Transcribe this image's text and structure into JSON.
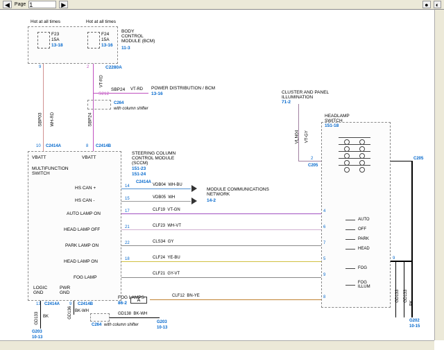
{
  "toolbar": {
    "prev": "◀",
    "next": "▶",
    "page_label": "Page",
    "page_value": "1",
    "btn1": "●",
    "btn2": "◐"
  },
  "hot": "Hot at all times",
  "fuses": {
    "f23": {
      "name": "F23",
      "amps": "15A",
      "ref": "13-18"
    },
    "f24": {
      "name": "F24",
      "amps": "15A",
      "ref": "13-16"
    }
  },
  "modules": {
    "bcm": {
      "title": "BODY\nCONTROL\nMODULE (BCM)",
      "ref": "11-3"
    },
    "multifunction": {
      "title": "MULTIFUNCTION\nSWITCH"
    },
    "sccm": {
      "title": "STEERING COLUMN\nCONTROL MODULE\n(SCCM)",
      "ref1": "151-23",
      "ref2": "151-24"
    },
    "headlamp": {
      "title": "HEADLAMP\nSWITCH",
      "ref": "151-18"
    },
    "mcn": {
      "title": "MODULE COMMUNICATIONS\nNETWORK",
      "ref": "14-2"
    },
    "cluster": {
      "title": "CLUSTER AND PANEL\nILLUMINATION",
      "ref": "71-2"
    },
    "pwr_dist": {
      "title": "POWER DISTRIBUTION / BCM",
      "ref": "13-16"
    },
    "fog_lamps": {
      "title": "FOG LAMPS",
      "ref": "86-2",
      "code": "A"
    }
  },
  "shifter_note": "with column shifter",
  "connectors": {
    "c2280a": "C2280A",
    "c2414a": "C2414A",
    "c2414b": "C2414B",
    "c264": "C264",
    "c205": "C205",
    "s212": "S212",
    "g202": "G202",
    "g203": "G203"
  },
  "grounds": {
    "gd133": "GD133",
    "gd136": "GD136",
    "gd138": "GD138",
    "g202": "G202",
    "g203": "G203",
    "ref": "10-13",
    "ref2": "10-15"
  },
  "pins": {
    "p2": "2",
    "p4": "4",
    "p5": "5",
    "p6": "6",
    "p7": "7",
    "p8": "8",
    "p9": "9",
    "p10": "10",
    "p13": "13",
    "p14": "14",
    "p15": "15",
    "p17": "17",
    "p18": "18",
    "p21": "21",
    "p22": "22"
  },
  "wires": {
    "sbp03": {
      "name": "SBP03",
      "color": "WH-RD"
    },
    "sbp24": {
      "name": "SBP24",
      "color": "VT-RD"
    },
    "vdb04": {
      "name": "VDB04",
      "color": "WH-BU"
    },
    "vdb05": {
      "name": "VDB05",
      "color": "WH"
    },
    "clf19": {
      "name": "CLF19",
      "color": "VT-GN"
    },
    "clf23": {
      "name": "CLF23",
      "color": "WH-VT"
    },
    "cls34": {
      "name": "CLS34",
      "color": "GY"
    },
    "clf24": {
      "name": "CLF24",
      "color": "YE-BU"
    },
    "clf21": {
      "name": "CLF21",
      "color": "GY-VT"
    },
    "clf12": {
      "name": "CLF12",
      "color": "BN-YE"
    },
    "vln04": {
      "name": "VLN04",
      "color": "VT-GY"
    },
    "bk": "BK",
    "bkwh": "BK-WH"
  },
  "signals": {
    "vbatt": "VBATT",
    "hscanp": "HS CAN +",
    "hscanm": "HS CAN -",
    "auto_lamp": "AUTO LAMP ON",
    "head_off": "HEAD LAMP OFF",
    "park_on": "PARK LAMP ON",
    "head_on": "HEAD LAMP ON",
    "fog": "FOG LAMP",
    "logic": "LOGIC\nGND",
    "pwr": "PWR\nGND"
  },
  "switch_pos": {
    "auto": "AUTO",
    "off": "OFF",
    "park": "PARK",
    "head": "HEAD",
    "fog": "FOG",
    "fog_illum": "FOG ILLUM"
  }
}
